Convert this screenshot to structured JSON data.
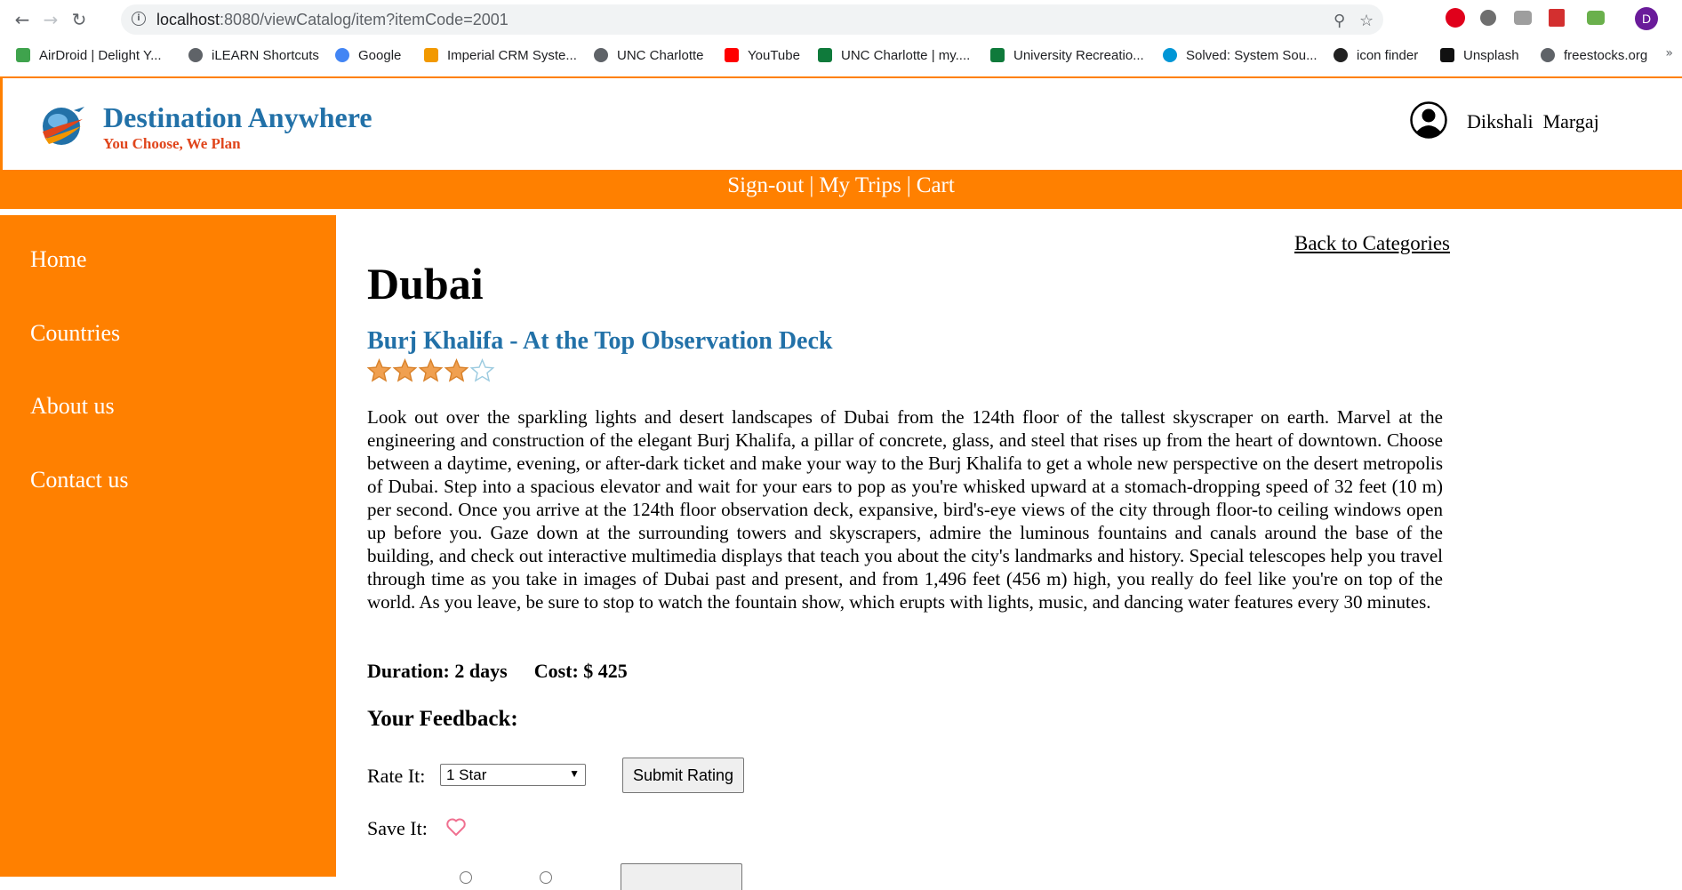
{
  "browser": {
    "url_host": "localhost",
    "url_rest": ":8080/viewCatalog/item?itemCode=2001",
    "profile_initial": "D",
    "bookmarks": [
      {
        "label": "AirDroid | Delight Y...",
        "icon": "airdroid-icon",
        "color": "#3fa34d"
      },
      {
        "label": "iLEARN Shortcuts",
        "icon": "globe-icon",
        "color": "#5f6368"
      },
      {
        "label": "Google",
        "icon": "google-icon",
        "color": "#4285f4"
      },
      {
        "label": "Imperial CRM Syste...",
        "icon": "crm-icon",
        "color": "#f29900"
      },
      {
        "label": "UNC Charlotte",
        "icon": "globe-icon",
        "color": "#5f6368"
      },
      {
        "label": "YouTube",
        "icon": "youtube-icon",
        "color": "#ff0000"
      },
      {
        "label": "UNC Charlotte | my....",
        "icon": "unc-icon",
        "color": "#0f7a3b"
      },
      {
        "label": "University Recreatio...",
        "icon": "unc-icon",
        "color": "#0f7a3b"
      },
      {
        "label": "Solved: System Sou...",
        "icon": "hp-icon",
        "color": "#0096d6"
      },
      {
        "label": "icon finder",
        "icon": "iconfinder-icon",
        "color": "#222222"
      },
      {
        "label": "Unsplash",
        "icon": "camera-icon",
        "color": "#111111"
      },
      {
        "label": "freestocks.org",
        "icon": "globe-icon",
        "color": "#5f6368"
      }
    ],
    "bookmarks_more": "»"
  },
  "header": {
    "brand_title": "Destination Anywhere",
    "brand_tagline": "You Choose, We Plan",
    "user_first": "Dikshali",
    "user_last": "Margaj"
  },
  "topnav": {
    "signout": "Sign-out",
    "sep1": "|",
    "mytrips": "My Trips",
    "sep2": "|",
    "cart": "Cart"
  },
  "sidebar": {
    "items": [
      {
        "label": "Home"
      },
      {
        "label": "Countries"
      },
      {
        "label": "About us"
      },
      {
        "label": "Contact us"
      }
    ]
  },
  "content": {
    "back_link": "Back to Categories",
    "city": "Dubai",
    "item_title": "Burj Khalifa - At the Top Observation Deck",
    "rating": 4,
    "rating_max": 5,
    "description": "Look out over the sparkling lights and desert landscapes of Dubai from the 124th floor of the tallest skyscraper on earth. Marvel at the engineering and construction of the elegant Burj Khalifa, a pillar of concrete, glass, and steel that rises up from the heart of downtown. Choose between a daytime, evening, or after-dark ticket and make your way to the Burj Khalifa to get a whole new perspective on the desert metropolis of Dubai. Step into a spacious elevator and wait for your ears to pop as you're whisked upward at a stomach-dropping speed of 32 feet (10 m) per second. Once you arrive at the 124th floor observation deck, expansive, bird's-eye views of the city through floor-to ceiling windows open up before you. Gaze down at the surrounding towers and skyscrapers, admire the luminous fountains and canals around the base of the building, and check out interactive multimedia displays that teach you about the city's landmarks and history. Special telescopes help you travel through time as you take in images of Dubai past and present, and from 1,496 feet (456 m) high, you really do feel like you're on top of the world. As you leave, be sure to stop to watch the fountain show, which erupts with lights, music, and dancing water features every 30 minutes.",
    "duration": "Duration: 2 days",
    "cost": "Cost: $ 425",
    "feedback_heading": "Your Feedback:",
    "rate_label": "Rate It:",
    "rate_selected": "1 Star",
    "submit_label": "Submit Rating",
    "save_label": "Save It:"
  },
  "colors": {
    "orange": "#ff8000",
    "brand_blue": "#2271a8",
    "tagline_red": "#e0451b",
    "star_fill": "#f0a050",
    "heart": "#f07090"
  }
}
